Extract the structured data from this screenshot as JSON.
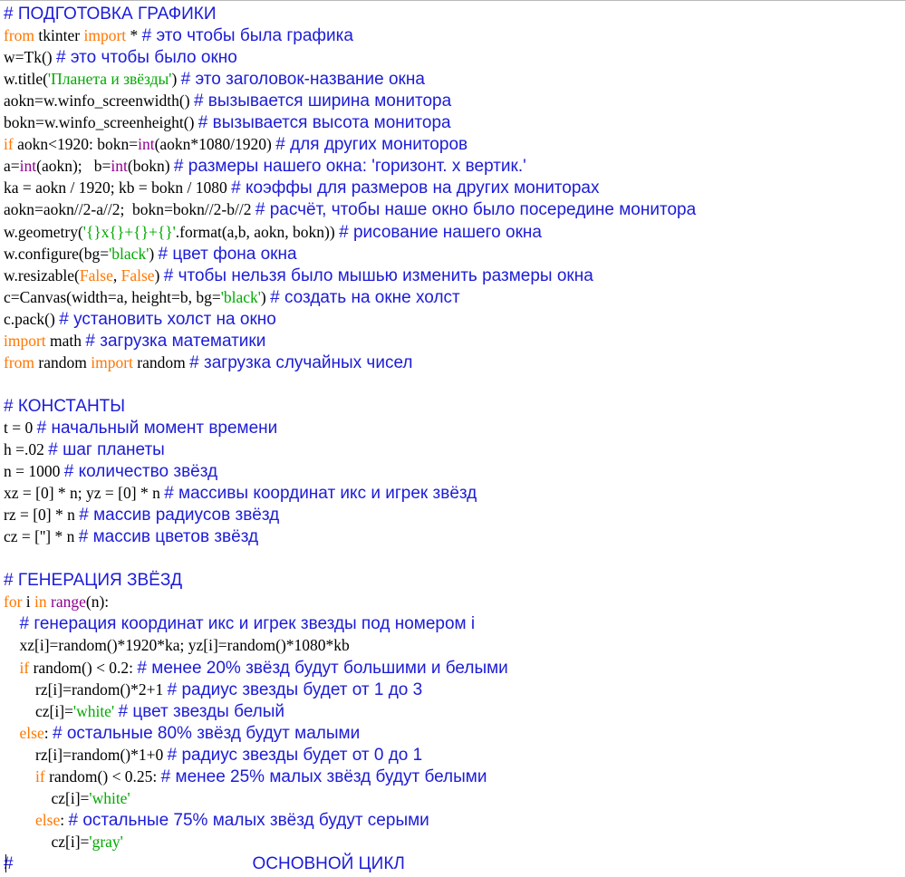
{
  "colors": {
    "code": "#000000",
    "keyword": "#ff7700",
    "builtin": "#900090",
    "string": "#00aa00",
    "comment": "#1c1cd8",
    "background": "#ffffff"
  },
  "lines": [
    [
      [
        "com",
        "# ПОДГОТОВКА ГРАФИКИ"
      ]
    ],
    [
      [
        "kw",
        "from"
      ],
      [
        "code",
        " tkinter "
      ],
      [
        "kw",
        "import"
      ],
      [
        "code",
        " * "
      ],
      [
        "com",
        "# это чтобы была графика"
      ]
    ],
    [
      [
        "code",
        "w=Tk() "
      ],
      [
        "com",
        "# это чтобы было окно"
      ]
    ],
    [
      [
        "code",
        "w.title("
      ],
      [
        "str",
        "'Планета и звёзды'"
      ],
      [
        "code",
        ") "
      ],
      [
        "com",
        "# это заголовок-название окна"
      ]
    ],
    [
      [
        "code",
        "aokn=w.winfo_screenwidth() "
      ],
      [
        "com",
        "# вызывается ширина монитора"
      ]
    ],
    [
      [
        "code",
        "bokn=w.winfo_screenheight() "
      ],
      [
        "com",
        "# вызывается высота монитора"
      ]
    ],
    [
      [
        "kw",
        "if"
      ],
      [
        "code",
        " aokn<1920: bokn="
      ],
      [
        "bi",
        "int"
      ],
      [
        "code",
        "(aokn*1080/1920) "
      ],
      [
        "com",
        "# для других мониторов"
      ]
    ],
    [
      [
        "code",
        "a="
      ],
      [
        "bi",
        "int"
      ],
      [
        "code",
        "(aokn);   b="
      ],
      [
        "bi",
        "int"
      ],
      [
        "code",
        "(bokn) "
      ],
      [
        "com",
        "# размеры нашего окна: 'горизонт. x вертик.'"
      ]
    ],
    [
      [
        "code",
        "ka = aokn / 1920; kb = bokn / 1080 "
      ],
      [
        "com",
        "# коэффы для размеров на других мониторах"
      ]
    ],
    [
      [
        "code",
        "aokn=aokn//2-a//2;  bokn=bokn//2-b//2 "
      ],
      [
        "com",
        "# расчёт, чтобы наше окно было посередине монитора"
      ]
    ],
    [
      [
        "code",
        "w.geometry("
      ],
      [
        "str",
        "'{}x{}+{}+{}'"
      ],
      [
        "code",
        ".format(a,b, aokn, bokn)) "
      ],
      [
        "com",
        "# рисование нашего окна"
      ]
    ],
    [
      [
        "code",
        "w.configure(bg="
      ],
      [
        "str",
        "'black'"
      ],
      [
        "code",
        ") "
      ],
      [
        "com",
        "# цвет фона окна"
      ]
    ],
    [
      [
        "code",
        "w.resizable("
      ],
      [
        "kw",
        "False"
      ],
      [
        "code",
        ", "
      ],
      [
        "kw",
        "False"
      ],
      [
        "code",
        ") "
      ],
      [
        "com",
        "# чтобы нельзя было мышью изменить размеры окна"
      ]
    ],
    [
      [
        "code",
        "c=Canvas(width=a, height=b, bg="
      ],
      [
        "str",
        "'black'"
      ],
      [
        "code",
        ") "
      ],
      [
        "com",
        "# создать на окне холст"
      ]
    ],
    [
      [
        "code",
        "c.pack() "
      ],
      [
        "com",
        "# установить холст на окно"
      ]
    ],
    [
      [
        "kw",
        "import"
      ],
      [
        "code",
        " math "
      ],
      [
        "com",
        "# загрузка математики"
      ]
    ],
    [
      [
        "kw",
        "from"
      ],
      [
        "code",
        " random "
      ],
      [
        "kw",
        "import"
      ],
      [
        "code",
        " random "
      ],
      [
        "com",
        "# загрузка случайных чисел"
      ]
    ],
    [],
    [
      [
        "com",
        "# КОНСТАНТЫ"
      ]
    ],
    [
      [
        "code",
        "t = 0 "
      ],
      [
        "com",
        "# начальный момент времени"
      ]
    ],
    [
      [
        "code",
        "h =.02 "
      ],
      [
        "com",
        "# шаг планеты"
      ]
    ],
    [
      [
        "code",
        "n = 1000 "
      ],
      [
        "com",
        "# количество звёзд"
      ]
    ],
    [
      [
        "code",
        "xz = [0] * n; yz = [0] * n "
      ],
      [
        "com",
        "# массивы координат икс и игрек звёзд"
      ]
    ],
    [
      [
        "code",
        "rz = [0] * n "
      ],
      [
        "com",
        "# массив радиусов звёзд"
      ]
    ],
    [
      [
        "code",
        "cz = [''] * n "
      ],
      [
        "com",
        "# массив цветов звёзд"
      ]
    ],
    [],
    [
      [
        "com",
        "# ГЕНЕРАЦИЯ ЗВЁЗД"
      ]
    ],
    [
      [
        "kw",
        "for"
      ],
      [
        "code",
        " i "
      ],
      [
        "kw",
        "in"
      ],
      [
        "code",
        " "
      ],
      [
        "bi",
        "range"
      ],
      [
        "code",
        "(n):"
      ]
    ],
    [
      [
        "code",
        "    "
      ],
      [
        "com",
        "# генерация координат икс и игрек звезды под номером i"
      ]
    ],
    [
      [
        "code",
        "    xz[i]=random()*1920*ka; yz[i]=random()*1080*kb"
      ]
    ],
    [
      [
        "code",
        "    "
      ],
      [
        "kw",
        "if"
      ],
      [
        "code",
        " random() < 0.2: "
      ],
      [
        "com",
        "# менее 20% звёзд будут большими и белыми"
      ]
    ],
    [
      [
        "code",
        "        rz[i]=random()*2+1 "
      ],
      [
        "com",
        "# радиус звезды будет от 1 до 3"
      ]
    ],
    [
      [
        "code",
        "        cz[i]="
      ],
      [
        "str",
        "'white'"
      ],
      [
        "code",
        " "
      ],
      [
        "com",
        "# цвет звезды белый"
      ]
    ],
    [
      [
        "code",
        "    "
      ],
      [
        "kw",
        "else"
      ],
      [
        "code",
        ": "
      ],
      [
        "com",
        "# остальные 80% звёзд будут малыми"
      ]
    ],
    [
      [
        "code",
        "        rz[i]=random()*1+0 "
      ],
      [
        "com",
        "# радиус звезды будет от 0 до 1"
      ]
    ],
    [
      [
        "code",
        "        "
      ],
      [
        "kw",
        "if"
      ],
      [
        "code",
        " random() < 0.25: "
      ],
      [
        "com",
        "# менее 25% малых звёзд будут белыми"
      ]
    ],
    [
      [
        "code",
        "            cz[i]="
      ],
      [
        "str",
        "'white'"
      ]
    ],
    [
      [
        "code",
        "        "
      ],
      [
        "kw",
        "else"
      ],
      [
        "code",
        ": "
      ],
      [
        "com",
        "# остальные 75% малых звёзд будут серыми"
      ]
    ],
    [
      [
        "code",
        "            cz[i]="
      ],
      [
        "str",
        "'gray'"
      ]
    ],
    [
      [
        "com",
        "#                                                  ОСНОВНОЙ ЦИКЛ"
      ]
    ]
  ]
}
